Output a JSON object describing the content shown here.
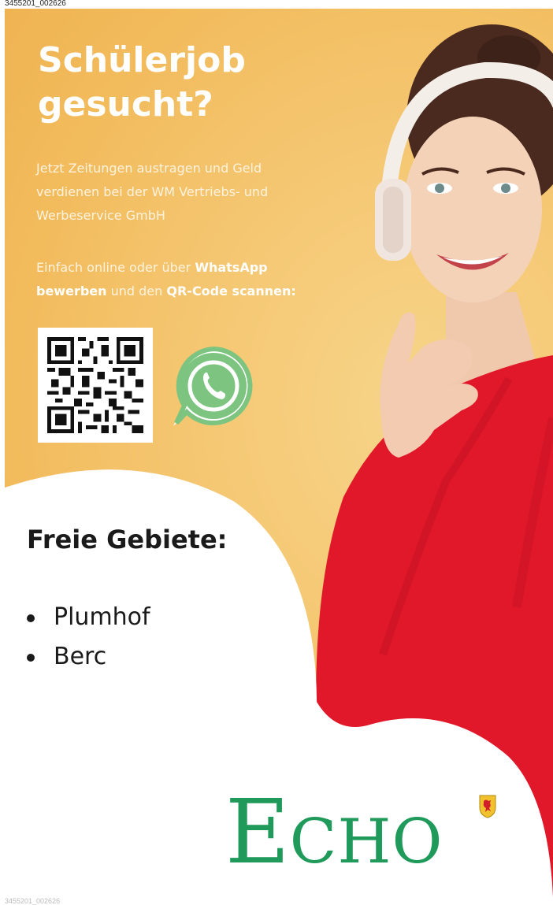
{
  "image_codes": {
    "top": "3455201_002626",
    "bottom": "3455201_002626"
  },
  "headline": {
    "line1": "Schülerjob",
    "line2": "gesucht?"
  },
  "intro_text": "Jetzt Zeitungen austragen und Geld verdienen bei der WM Vertriebs- und Werbeservice GmbH",
  "cta": {
    "part1": "Einfach online oder über ",
    "bold1": "WhatsApp bewerben",
    "part2": " und den ",
    "bold2": "QR-Code scannen:"
  },
  "icons": {
    "qr": "qr-code-icon",
    "whatsapp": "whatsapp-icon",
    "crest": "crest-icon"
  },
  "areas": {
    "title": "Freie Gebiete:",
    "items": [
      "Plumhof",
      "Berc"
    ]
  },
  "logo": {
    "initial": "E",
    "rest": "CHO"
  },
  "colors": {
    "background": "#f2bb5c",
    "sweater": "#e0182a",
    "whatsapp": "#7cc47f",
    "logo": "#1f9a5a",
    "text_light": "#ffffff"
  }
}
